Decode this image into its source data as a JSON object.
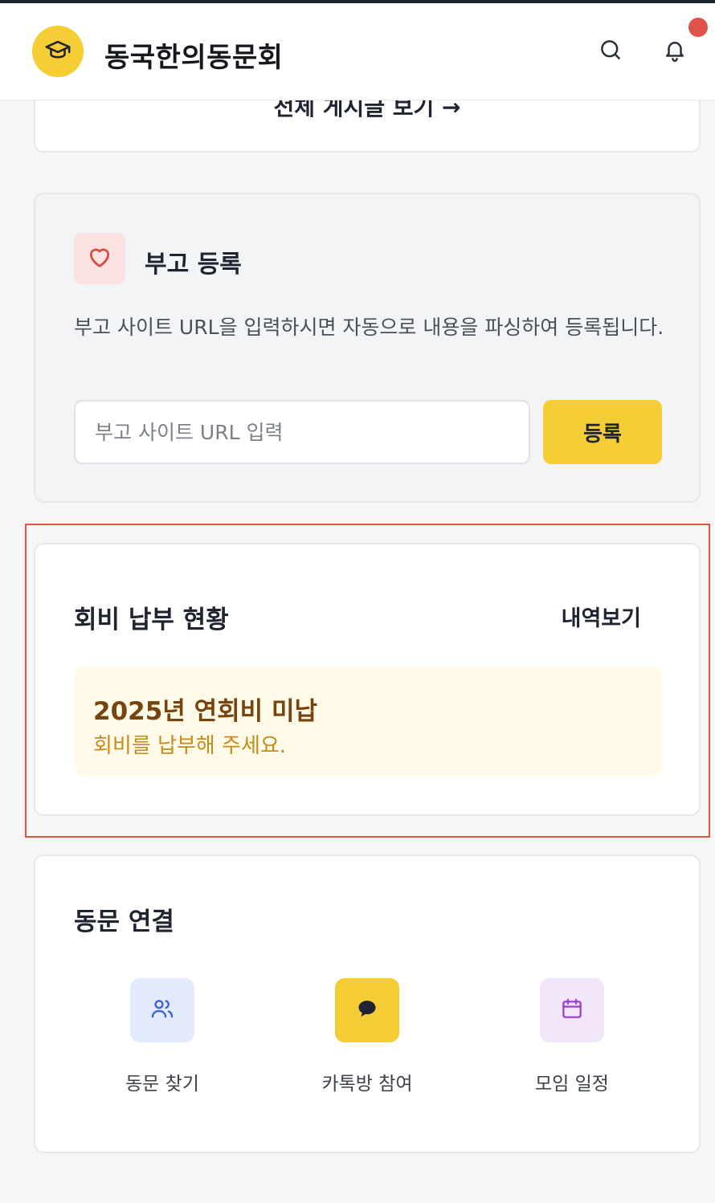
{
  "header": {
    "app_title": "동국한의동문회",
    "logo_icon": "graduation-cap-icon",
    "search_icon": "search-icon",
    "bell_icon": "bell-icon",
    "accent_color": "#f5cd34",
    "notification_dot_color": "#de5248"
  },
  "top_card": {
    "link_text": "전체 게시글 보기 →"
  },
  "obituary": {
    "icon": "heart-icon",
    "title": "부고 등록",
    "description": "부고 사이트 URL을 입력하시면 자동으로 내용을 파싱하여 등록됩니다.",
    "input_placeholder": "부고 사이트 URL 입력",
    "input_value": "",
    "submit_label": "등록"
  },
  "membership_fee": {
    "title": "회비 납부 현황",
    "history_link": "내역보기",
    "status_title": "2025년 연회비 미납",
    "status_message": "회비를 납부해 주세요."
  },
  "alumni_connect": {
    "title": "동문 연결",
    "items": [
      {
        "label": "동문 찾기",
        "icon": "users-icon",
        "tile_color": "#e2eafb"
      },
      {
        "label": "카톡방 참여",
        "icon": "chat-bubble-icon",
        "tile_color": "#f5cd34"
      },
      {
        "label": "모임 일정",
        "icon": "calendar-icon",
        "tile_color": "#f0e5f9"
      }
    ]
  }
}
